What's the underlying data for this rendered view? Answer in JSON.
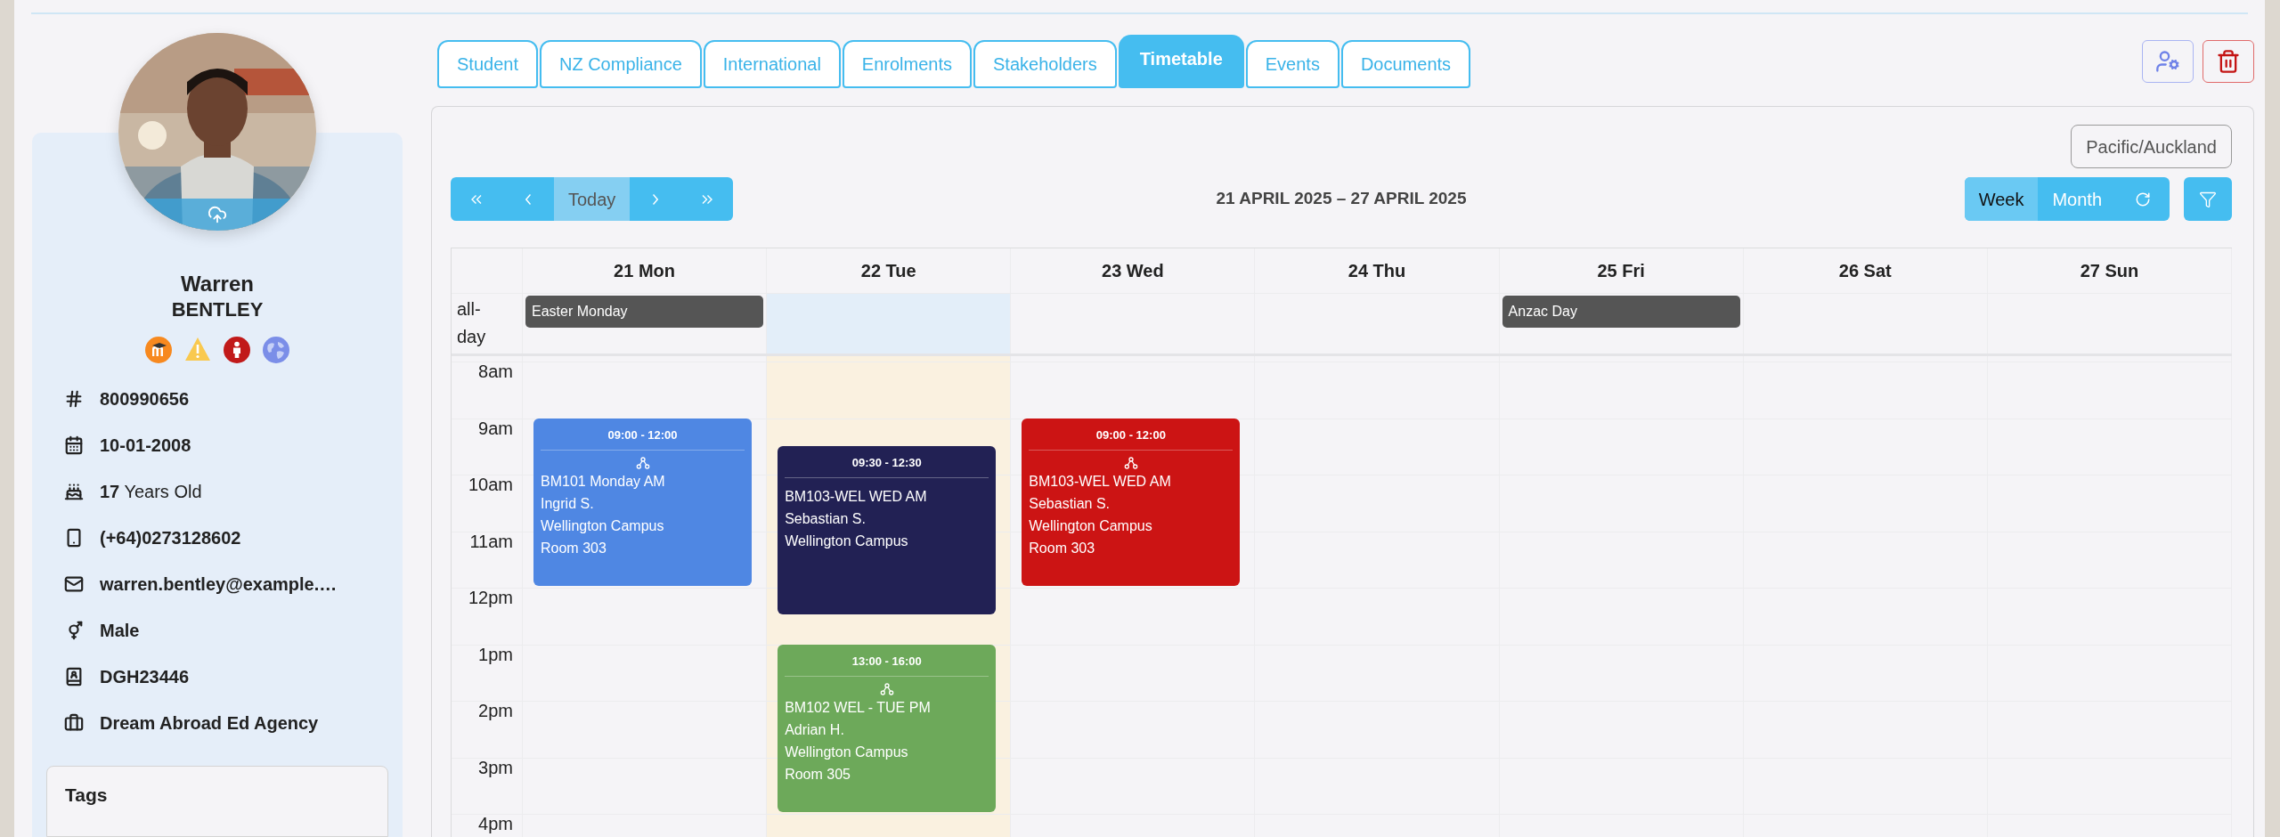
{
  "tabs": [
    {
      "label": "Student",
      "selected": false
    },
    {
      "label": "NZ Compliance",
      "selected": false
    },
    {
      "label": "International",
      "selected": false
    },
    {
      "label": "Enrolments",
      "selected": false
    },
    {
      "label": "Stakeholders",
      "selected": false
    },
    {
      "label": "Timetable",
      "selected": true
    },
    {
      "label": "Events",
      "selected": false
    },
    {
      "label": "Documents",
      "selected": false
    }
  ],
  "profile": {
    "first_name": "Warren",
    "last_name": "BENTLEY",
    "details": [
      {
        "text": "800990656",
        "kind": "bold"
      },
      {
        "text": "10-01-2008",
        "kind": "bold"
      },
      {
        "text": "**17** Years Old",
        "kind": "mixed"
      },
      {
        "text": "(+64)0273128602",
        "kind": "bold"
      },
      {
        "text": "warren.bentley@example.…",
        "kind": "bold"
      },
      {
        "text": "Male",
        "kind": "bold"
      },
      {
        "text": "DGH23446",
        "kind": "bold"
      },
      {
        "text": "Dream Abroad Ed Agency",
        "kind": "bold"
      }
    ],
    "tags_title": "Tags"
  },
  "calendar": {
    "timezone": "Pacific/Auckland",
    "today_button": {
      "label": "Today",
      "disabled": true
    },
    "range": "21 APRIL 2025 – 27 APRIL 2025",
    "views": [
      {
        "label": "Week",
        "selected": true
      },
      {
        "label": "Month",
        "selected": false
      }
    ],
    "all_day_label": "all-day",
    "hours": [
      "8am",
      "9am",
      "10am",
      "11am",
      "12pm",
      "1pm",
      "2pm",
      "3pm",
      "4pm"
    ],
    "days": [
      {
        "label": "21 Mon",
        "today": false,
        "all_day": [
          {
            "title": "Easter Monday"
          }
        ],
        "events": [
          {
            "time": "09:00 - 12:00",
            "color": "#4f87e3",
            "grouped": true,
            "lines": [
              "BM101 Monday AM",
              "Ingrid S.",
              "Wellington Campus",
              "Room 303"
            ]
          }
        ]
      },
      {
        "label": "22 Tue",
        "today": true,
        "events": [
          {
            "time": "09:30 - 12:30",
            "color": "#222154",
            "grouped": false,
            "lines": [
              "BM103-WEL WED AM",
              "Sebastian S.",
              "Wellington Campus"
            ]
          },
          {
            "time": "13:00 - 16:00",
            "color": "#6da95a",
            "grouped": true,
            "lines": [
              "BM102 WEL - TUE PM",
              "Adrian H.",
              "Wellington Campus",
              "Room 305"
            ]
          }
        ]
      },
      {
        "label": "23 Wed",
        "today": false,
        "events": [
          {
            "time": "09:00 - 12:00",
            "color": "#cc1414",
            "grouped": true,
            "lines": [
              "BM103-WEL WED AM",
              "Sebastian S.",
              "Wellington Campus",
              "Room 303"
            ]
          }
        ]
      },
      {
        "label": "24 Thu",
        "today": false
      },
      {
        "label": "25 Fri",
        "today": false,
        "all_day": [
          {
            "title": "Anzac Day"
          }
        ]
      },
      {
        "label": "26 Sat",
        "today": false
      },
      {
        "label": "27 Sun",
        "today": false
      }
    ]
  }
}
